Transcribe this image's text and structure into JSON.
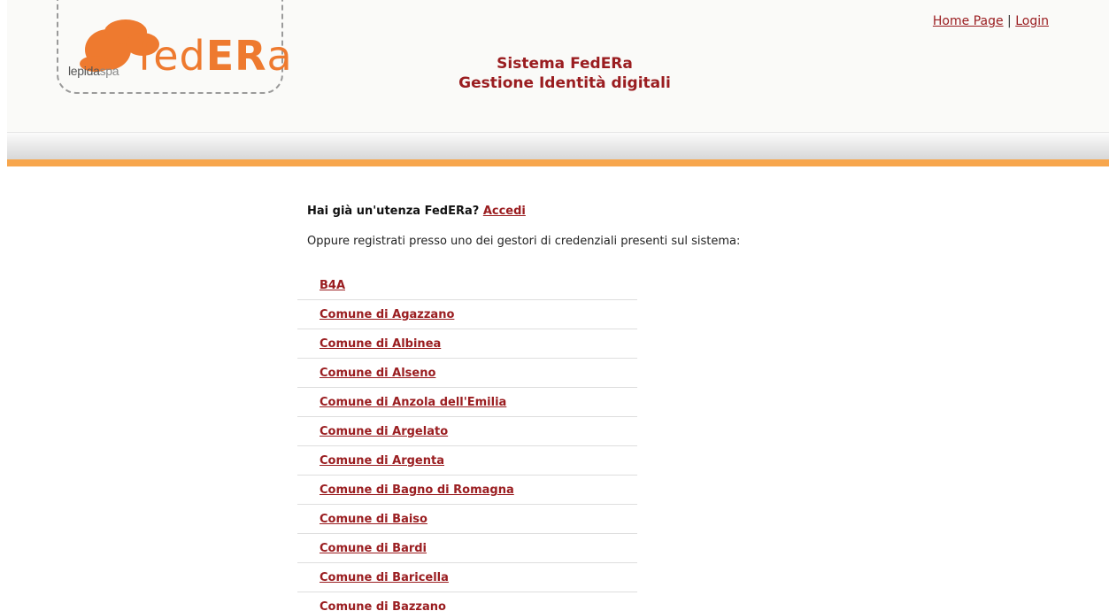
{
  "header": {
    "logo": {
      "small_text_main": "lepida",
      "small_text_suffix": "spa",
      "big_text_fed": "fed",
      "big_text_er": "ER",
      "big_text_a": "a"
    },
    "title_line1": "Sistema FedERa",
    "title_line2": "Gestione Identità digitali",
    "links": {
      "home": "Home Page",
      "separator": "|",
      "login": "Login"
    }
  },
  "main": {
    "already_text": "Hai già un'utenza FedERa?",
    "login_link": "Accedi",
    "register_text": "Oppure registrati presso uno dei gestori di credenziali presenti sul sistema:",
    "providers": [
      "B4A",
      "Comune di Agazzano",
      "Comune di Albinea",
      "Comune di Alseno",
      "Comune di Anzola dell'Emilia",
      "Comune di Argelato",
      "Comune di Argenta",
      "Comune di Bagno di Romagna",
      "Comune di Baiso",
      "Comune di Bardi",
      "Comune di Baricella",
      "Comune di Bazzano"
    ]
  },
  "colors": {
    "accent": "#9a1d20",
    "orange_bar": "#f7a64d",
    "logo_orange": "#ee7a2f"
  }
}
